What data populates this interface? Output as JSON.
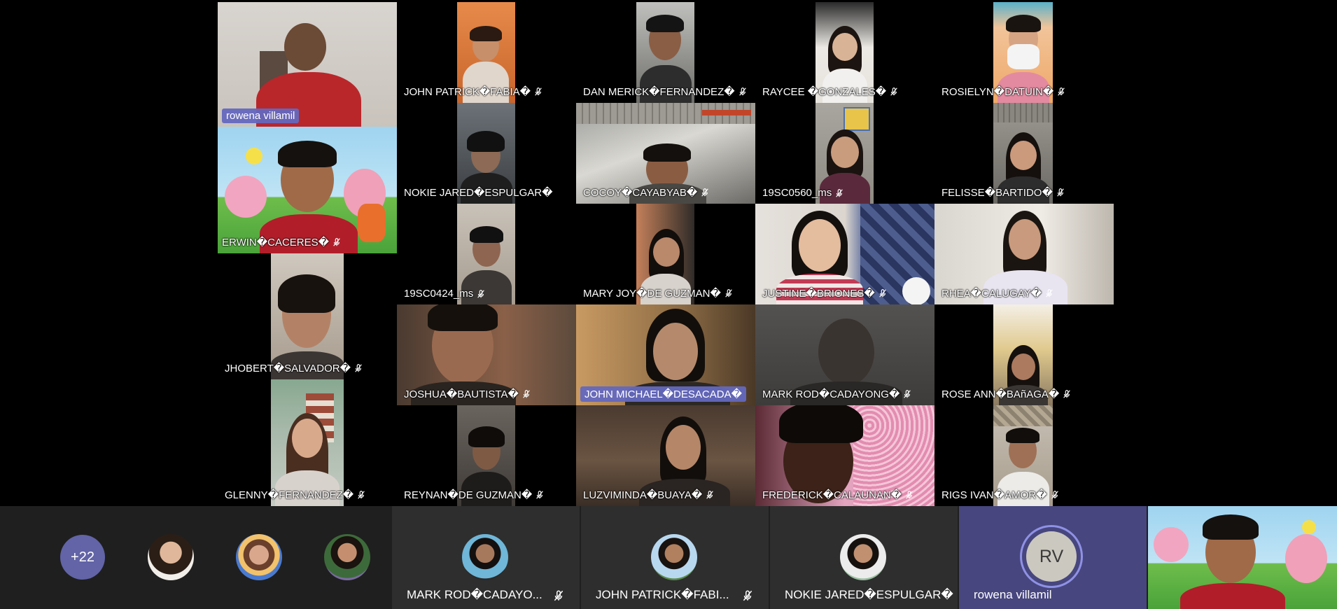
{
  "participants": [
    {
      "name": "rowena villamil",
      "muted": false,
      "boxed": true
    },
    {
      "name": "JOHN PATRICK�FABIA�",
      "muted": true
    },
    {
      "name": "DAN MERICK�FERNANDEZ�",
      "muted": true
    },
    {
      "name": "RAYCEE �GONZALES�",
      "muted": true
    },
    {
      "name": "ROSIELYN�DATUIN�",
      "muted": true
    },
    {
      "name": "ERWIN�CACERES�",
      "muted": true
    },
    {
      "name": "NOKIE JARED�ESPULGAR�",
      "muted": false
    },
    {
      "name": "COCOY�CAYABYAB�",
      "muted": true
    },
    {
      "name": "19SC0560_ms",
      "muted": true
    },
    {
      "name": "FELISSE�BARTIDO�",
      "muted": true
    },
    {
      "name": "19SC0424_ms",
      "muted": true
    },
    {
      "name": "MARY JOY�DE GUZMAN�",
      "muted": true
    },
    {
      "name": "JUSTINE�BRIONES�",
      "muted": true
    },
    {
      "name": "RHEA�CALUGAY�",
      "muted": true
    },
    {
      "name": "JHOBERT�SALVADOR�",
      "muted": true
    },
    {
      "name": "JOSHUA�BAUTISTA�",
      "muted": true
    },
    {
      "name": "JOHN MICHAEL�DESACADA�",
      "muted": false,
      "boxed": true
    },
    {
      "name": "MARK ROD�CADAYONG�",
      "muted": true
    },
    {
      "name": "ROSE ANN�BAñAGA�",
      "muted": true
    },
    {
      "name": "GLENNY�FERNANDEZ�",
      "muted": true
    },
    {
      "name": "REYNAN�DE GUZMAN�",
      "muted": true
    },
    {
      "name": "LUZVIMINDA�BUAYA�",
      "muted": true
    },
    {
      "name": "FREDERICK�CALAUNAN�",
      "muted": true
    },
    {
      "name": "RIGS IVAN�AMOR�",
      "muted": true
    }
  ],
  "strip": {
    "overflow_count": "+22",
    "named": [
      {
        "name": "MARK ROD�CADAYO...",
        "muted": true
      },
      {
        "name": "JOHN PATRICK�FABI...",
        "muted": true
      },
      {
        "name": "NOKIE JARED�ESPULGAR�",
        "muted": false
      },
      {
        "name": "rowena villamil",
        "muted": false,
        "initials": "RV"
      }
    ]
  },
  "colors": {
    "accent": "#6264a7",
    "strip_background": "#1f1f1f",
    "strip_cell_background": "#2e2e2e",
    "speaker_background": "#47467e"
  },
  "icons": [
    "mic-off-icon"
  ]
}
